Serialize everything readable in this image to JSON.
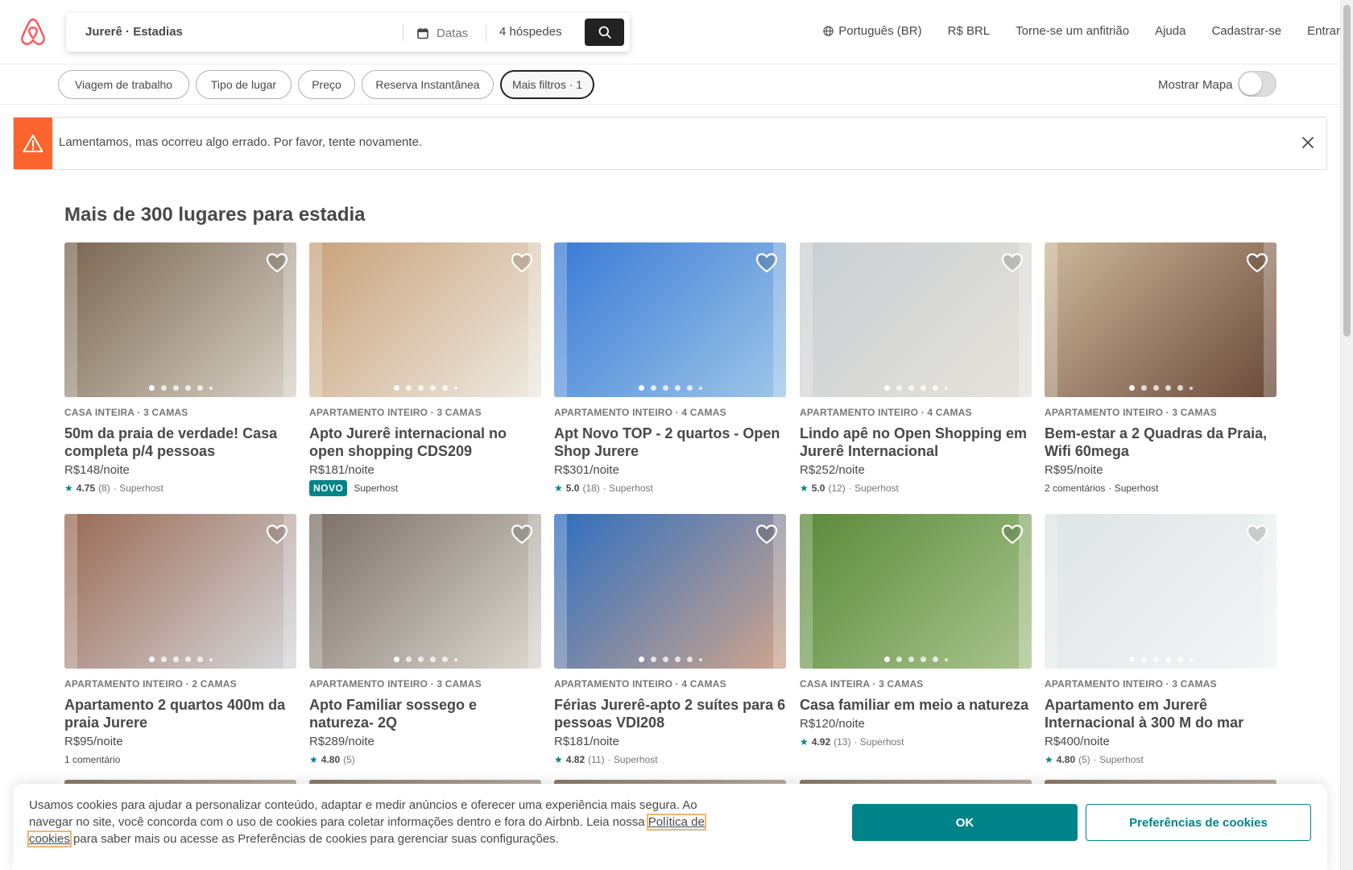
{
  "header": {
    "search_location": "Jurerê · Estadias",
    "dates_label": "Datas",
    "guests_label": "4 hóspedes",
    "nav": [
      "Português (BR)",
      "R$ BRL",
      "Torne-se um anfitrião",
      "Ajuda",
      "Cadastrar-se",
      "Entrar"
    ]
  },
  "filters": {
    "pills": [
      "Viagem de trabalho",
      "Tipo de lugar",
      "Preço",
      "Reserva Instantânea",
      "Mais filtros · 1"
    ],
    "map_label": "Mostrar Mapa"
  },
  "error": {
    "message": "Lamentamos, mas ocorreu algo errado. Por favor, tente novamente."
  },
  "main": {
    "title": "Mais de 300 lugares para estadia",
    "listings": [
      {
        "type": "CASA INTEIRA · 3 CAMAS",
        "title": "50m da praia de verdade! Casa completa p/4 pessoas",
        "price": "R$148/noite",
        "rating": "4.75",
        "reviews": "(8)",
        "host": "· Superhost"
      },
      {
        "type": "APARTAMENTO INTEIRO · 3 CAMAS",
        "title": "Apto Jurerê internacional no open shopping CDS209",
        "price": "R$181/noite",
        "badge": "NOVO",
        "host": "Superhost"
      },
      {
        "type": "APARTAMENTO INTEIRO · 4 CAMAS",
        "title": "Apt Novo TOP - 2 quartos - Open Shop Jurere",
        "price": "R$301/noite",
        "rating": "5.0",
        "reviews": "(18)",
        "host": "· Superhost"
      },
      {
        "type": "APARTAMENTO INTEIRO · 4 CAMAS",
        "title": "Lindo apê no Open Shopping em Jurerê Internacional",
        "price": "R$252/noite",
        "rating": "5.0",
        "reviews": "(12)",
        "host": "· Superhost"
      },
      {
        "type": "APARTAMENTO INTEIRO · 3 CAMAS",
        "title": "Bem-estar a 2 Quadras da Praia, Wifi 60mega",
        "price": "R$95/noite",
        "comments": "2 comentários",
        "host": "· Superhost"
      },
      {
        "type": "APARTAMENTO INTEIRO · 2 CAMAS",
        "title": "Apartamento 2 quartos 400m da praia Jurere",
        "price": "R$95/noite",
        "comments": "1 comentário"
      },
      {
        "type": "APARTAMENTO INTEIRO · 3 CAMAS",
        "title": "Apto Familiar sossego e natureza- 2Q",
        "price": "R$289/noite",
        "rating": "4.80",
        "reviews": "(5)"
      },
      {
        "type": "APARTAMENTO INTEIRO · 4 CAMAS",
        "title": "Férias Jurerê-apto 2 suítes para 6 pessoas VDI208",
        "price": "R$181/noite",
        "rating": "4.82",
        "reviews": "(11)",
        "host": "· Superhost"
      },
      {
        "type": "CASA INTEIRA · 3 CAMAS",
        "title": "Casa familiar em meio a natureza",
        "price": "R$120/noite",
        "rating": "4.92",
        "reviews": "(13)",
        "host": "· Superhost"
      },
      {
        "type": "APARTAMENTO INTEIRO · 3 CAMAS",
        "title": "Apartamento em Jurerê Internacional à 300 M do mar",
        "price": "R$400/noite",
        "rating": "4.80",
        "reviews": "(5)",
        "host": "· Superhost"
      }
    ]
  },
  "cookie": {
    "text_before": "Usamos cookies para ajudar a personalizar conteúdo, adaptar e medir anúncios e oferecer uma experiência mais segura. Ao navegar no site, você concorda com o uso de cookies para coletar informações dentro e fora do Airbnb. Leia nossa ",
    "link": "Política de cookies",
    "text_after": " para saber mais ou acesse as Preferências de cookies para gerenciar suas configurações.",
    "ok": "OK",
    "preferences": "Preferências de cookies"
  },
  "colors": {
    "brand": "#FF5A5F",
    "teal": "#008489",
    "warning": "#FC642D",
    "text": "#484848"
  }
}
